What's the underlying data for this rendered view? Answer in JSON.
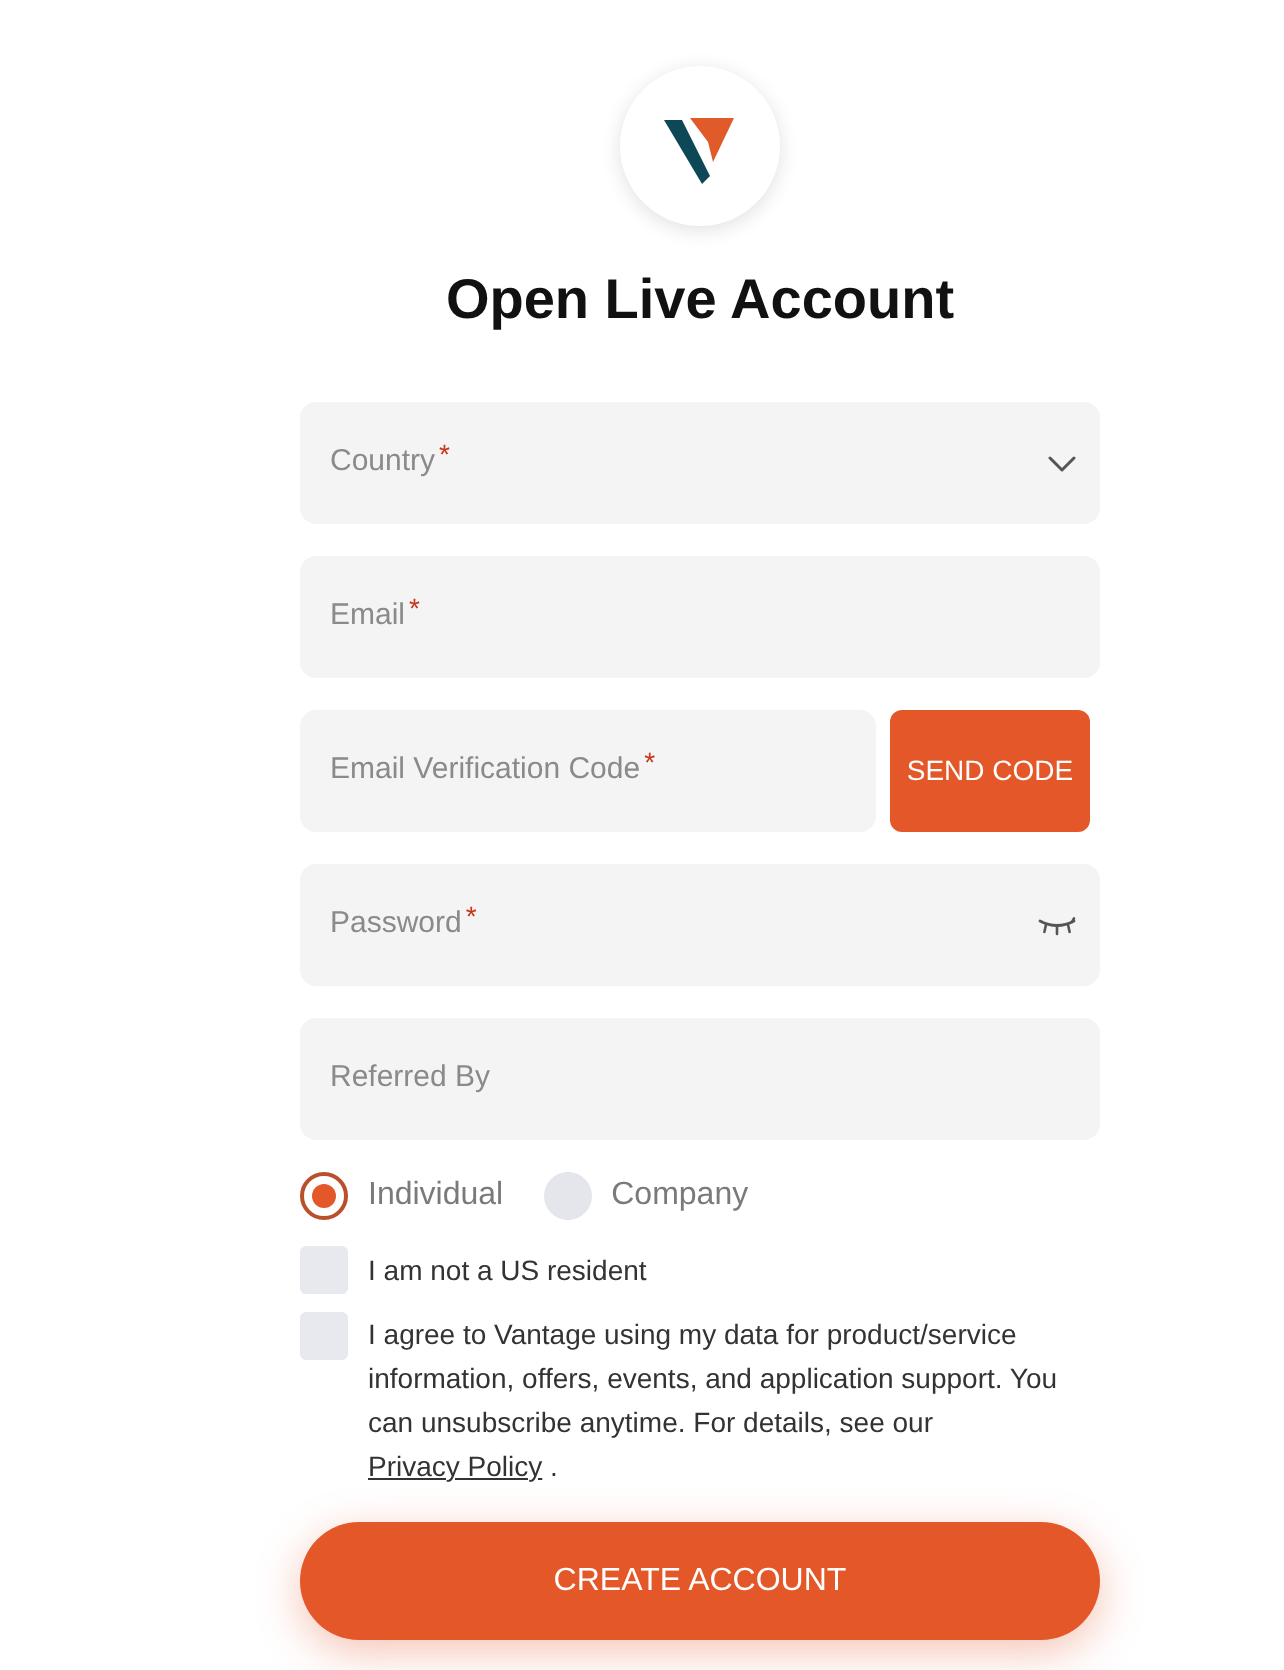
{
  "title": "Open Live Account",
  "fields": [
    {
      "kind": "select",
      "placeholder": "Country",
      "required_mark": "*"
    },
    {
      "kind": "text",
      "placeholder": "Email",
      "required_mark": "*"
    },
    {
      "kind": "code",
      "placeholder": "Email Verification Code",
      "required_mark": "*",
      "button": "SEND CODE"
    },
    {
      "kind": "password",
      "placeholder": "Password",
      "required_mark": "*"
    },
    {
      "kind": "text",
      "placeholder": "Referred By"
    }
  ],
  "account_type": [
    {
      "label": "Individual",
      "selected": true
    },
    {
      "label": "Company",
      "selected": false
    }
  ],
  "agreements": [
    {
      "text": "I am not a US resident",
      "checked": false
    },
    {
      "text": "I agree to Vantage using my data for product/service information, offers, events, and application support. You can unsubscribe anytime. For details, see our",
      "link": "Privacy Policy",
      "text_after": " .",
      "checked": false
    }
  ],
  "submit_button": "CREATE ACCOUNT"
}
